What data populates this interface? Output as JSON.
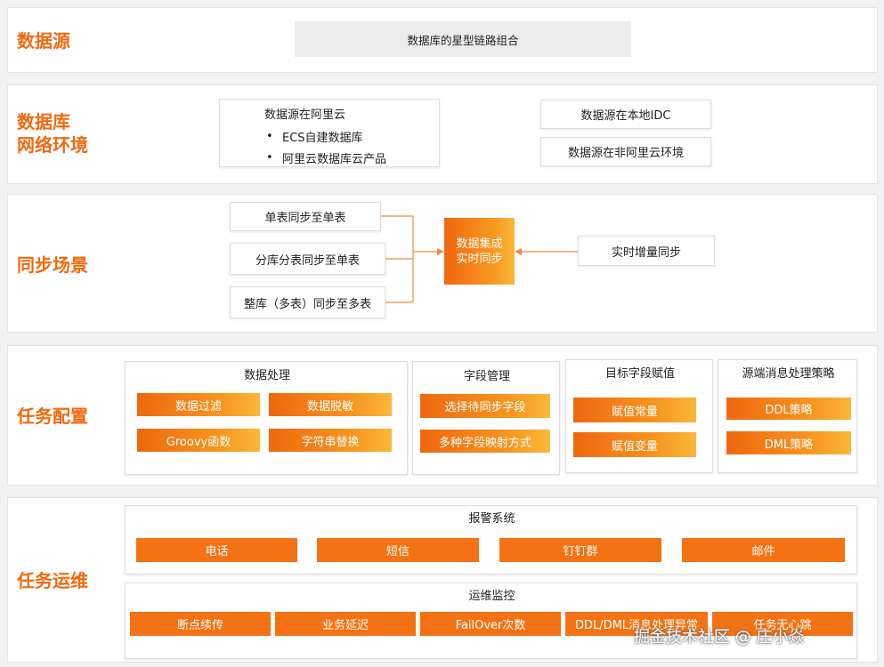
{
  "sections": {
    "source": {
      "title": "数据源",
      "star_box": "数据库的星型链路组合"
    },
    "network": {
      "title_line1": "数据库",
      "title_line2": "网络环境",
      "aliyun_title": "数据源在阿里云",
      "aliyun_items": [
        "ECS自建数据库",
        "阿里云数据库云产品"
      ],
      "bullet": "•",
      "local_idc": "数据源在本地IDC",
      "non_aliyun": "数据源在非阿里云环境"
    },
    "sync": {
      "title": "同步场景",
      "left_items": [
        "单表同步至单表",
        "分库分表同步至单表",
        "整库（多表）同步至多表"
      ],
      "center_line1": "数据集成",
      "center_line2": "实时同步",
      "right_item": "实时增量同步"
    },
    "task_config": {
      "title": "任务配置",
      "data_processing": {
        "title": "数据处理",
        "buttons": [
          "数据过滤",
          "数据脱敏",
          "Groovy函数",
          "字符串替换"
        ]
      },
      "field_mgmt": {
        "title": "字段管理",
        "buttons": [
          "选择待同步字段",
          "多种字段映射方式"
        ]
      },
      "target_field": {
        "title": "目标字段赋值",
        "buttons": [
          "赋值常量",
          "赋值变量"
        ]
      },
      "source_msg": {
        "title": "源端消息处理策略",
        "buttons": [
          "DDL策略",
          "DML策略"
        ]
      }
    },
    "ops": {
      "title": "任务运维",
      "alarm": {
        "title": "报警系统",
        "buttons": [
          "电话",
          "短信",
          "钉钉群",
          "邮件"
        ]
      },
      "monitor": {
        "title": "运维监控",
        "buttons": [
          "断点续传",
          "业务延迟",
          "FailOver次数",
          "DDL/DML消息处理异常",
          "任务无心跳"
        ]
      }
    }
  },
  "watermark": "掘金技术社区 @ 庄小焱",
  "colors": {
    "accent": "#f16a0f",
    "button": "#f47214",
    "gradient_end": "#fbb83a"
  }
}
